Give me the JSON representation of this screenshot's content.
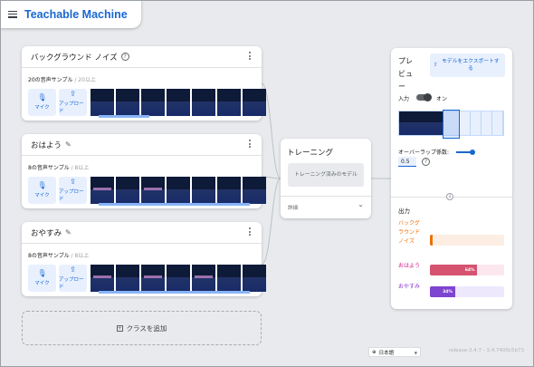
{
  "app": {
    "title": "Teachable Machine"
  },
  "upload_button_labels": {
    "mic": "マイク",
    "upload": "アップロード"
  },
  "classes": [
    {
      "name": "バックグラウンド ノイズ",
      "count": "20の音声サンプル",
      "min": " / 20以上"
    },
    {
      "name": "おはよう",
      "count": "8の音声サンプル",
      "min": " / 8以上"
    },
    {
      "name": "おやすみ",
      "count": "8の音声サンプル",
      "min": " / 8以上"
    }
  ],
  "add_class": {
    "label": "クラスを追加"
  },
  "training": {
    "title": "トレーニング",
    "button": "トレーニング済みのモデル",
    "details": "詳細"
  },
  "preview": {
    "title": "プレビュー",
    "export_button": "モデルをエクスポートする",
    "input_label": "入力",
    "toggle_state": "オン",
    "overlap_label": "オーバーラップ係数:",
    "overlap_value": "0.5",
    "output_label": "出力",
    "results": [
      {
        "label": "バックグラウンドノイズ",
        "value": 0.02,
        "percent_text": "",
        "color": "#e8710a",
        "track": "#fdeee3",
        "fill": "#e8710a"
      },
      {
        "label": "おはよう",
        "value": 0.64,
        "percent_text": "64%",
        "color": "#d01884",
        "track": "#fde7ef",
        "fill": "#d5536f"
      },
      {
        "label": "おやすみ",
        "value": 0.34,
        "percent_text": "34%",
        "color": "#8430ce",
        "track": "#eee8fd",
        "fill": "#7e45d0"
      }
    ]
  },
  "footer": {
    "language": "日本語",
    "version": "release-2.4.7 - 3.4.7400c5b73"
  }
}
